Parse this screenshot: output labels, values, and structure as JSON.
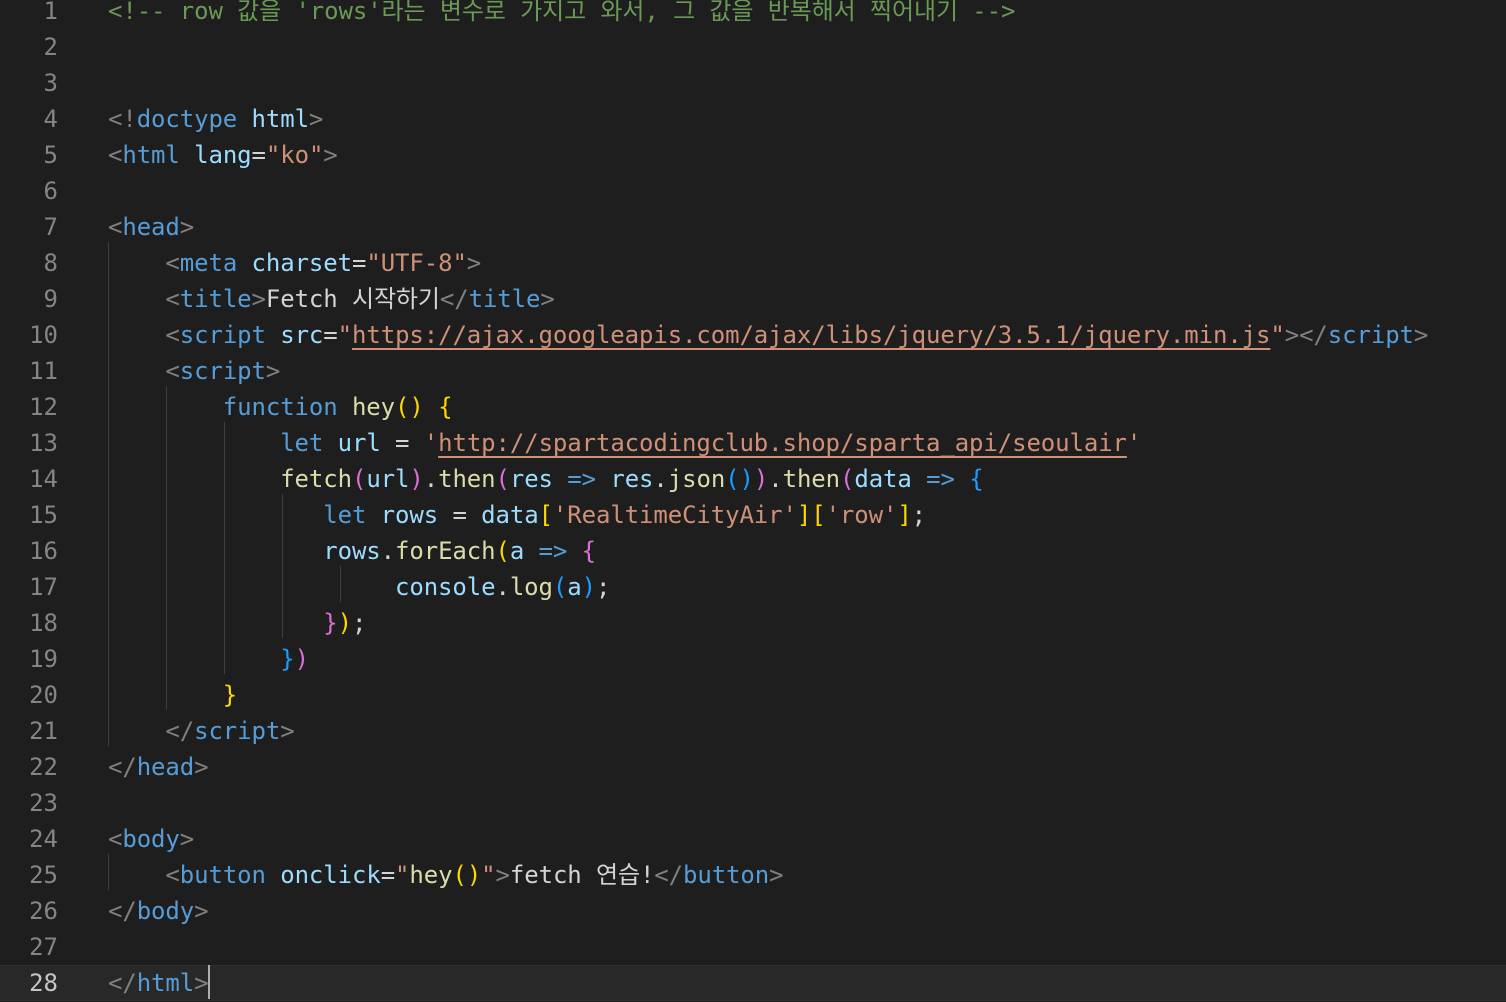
{
  "editor": {
    "theme_colors": {
      "background": "#1e1e1e",
      "line_number": "#858585",
      "comment": "#6a9955",
      "tag": "#569cd6",
      "attribute": "#9cdcfe",
      "string": "#ce9178",
      "function": "#dcdcaa",
      "bracket_1": "#ffd700",
      "bracket_2": "#da70d6",
      "bracket_3": "#179fff"
    },
    "current_line": 28,
    "lines": [
      {
        "n": "1",
        "tokens": [
          [
            "t-comment",
            "<!-- row 값을 'rows'라는 변수로 가지고 와서, 그 값을 반복해서 찍어내기 -->"
          ]
        ]
      },
      {
        "n": "2",
        "tokens": []
      },
      {
        "n": "3",
        "tokens": []
      },
      {
        "n": "4",
        "tokens": [
          [
            "t-punct",
            "<!"
          ],
          [
            "t-tag",
            "doctype"
          ],
          [
            "t-text",
            " "
          ],
          [
            "t-attr",
            "html"
          ],
          [
            "t-punct",
            ">"
          ]
        ]
      },
      {
        "n": "5",
        "tokens": [
          [
            "t-punct",
            "<"
          ],
          [
            "t-tag",
            "html"
          ],
          [
            "t-text",
            " "
          ],
          [
            "t-attr",
            "lang"
          ],
          [
            "t-text",
            "="
          ],
          [
            "t-str",
            "\"ko\""
          ],
          [
            "t-punct",
            ">"
          ]
        ]
      },
      {
        "n": "6",
        "tokens": []
      },
      {
        "n": "7",
        "tokens": [
          [
            "t-punct",
            "<"
          ],
          [
            "t-tag",
            "head"
          ],
          [
            "t-punct",
            ">"
          ]
        ]
      },
      {
        "n": "8",
        "tokens": [
          [
            "t-text",
            "    "
          ],
          [
            "t-punct",
            "<"
          ],
          [
            "t-tag",
            "meta"
          ],
          [
            "t-text",
            " "
          ],
          [
            "t-attr",
            "charset"
          ],
          [
            "t-text",
            "="
          ],
          [
            "t-str",
            "\"UTF-8\""
          ],
          [
            "t-punct",
            ">"
          ]
        ]
      },
      {
        "n": "9",
        "tokens": [
          [
            "t-text",
            "    "
          ],
          [
            "t-punct",
            "<"
          ],
          [
            "t-tag",
            "title"
          ],
          [
            "t-punct",
            ">"
          ],
          [
            "t-text",
            "Fetch 시작하기"
          ],
          [
            "t-punct",
            "</"
          ],
          [
            "t-tag",
            "title"
          ],
          [
            "t-punct",
            ">"
          ]
        ]
      },
      {
        "n": "10",
        "tokens": [
          [
            "t-text",
            "    "
          ],
          [
            "t-punct",
            "<"
          ],
          [
            "t-tag",
            "script"
          ],
          [
            "t-text",
            " "
          ],
          [
            "t-attr",
            "src"
          ],
          [
            "t-text",
            "="
          ],
          [
            "t-str",
            "\""
          ],
          [
            "t-url",
            "https://ajax.googleapis.com/ajax/libs/jquery/3.5.1/jquery.min.js"
          ],
          [
            "t-str",
            "\""
          ],
          [
            "t-punct",
            "></"
          ],
          [
            "t-tag",
            "script"
          ],
          [
            "t-punct",
            ">"
          ]
        ]
      },
      {
        "n": "11",
        "tokens": [
          [
            "t-text",
            "    "
          ],
          [
            "t-punct",
            "<"
          ],
          [
            "t-tag",
            "script"
          ],
          [
            "t-punct",
            ">"
          ]
        ]
      },
      {
        "n": "12",
        "tokens": [
          [
            "t-text",
            "        "
          ],
          [
            "t-kw",
            "function"
          ],
          [
            "t-text",
            " "
          ],
          [
            "t-fn",
            "hey"
          ],
          [
            "t-b1",
            "()"
          ],
          [
            "t-text",
            " "
          ],
          [
            "t-b1",
            "{"
          ]
        ]
      },
      {
        "n": "13",
        "tokens": [
          [
            "t-text",
            "            "
          ],
          [
            "t-kw",
            "let"
          ],
          [
            "t-text",
            " "
          ],
          [
            "t-var",
            "url"
          ],
          [
            "t-text",
            " "
          ],
          [
            "t-op",
            "="
          ],
          [
            "t-text",
            " "
          ],
          [
            "t-str",
            "'"
          ],
          [
            "t-url",
            "http://spartacodingclub.shop/sparta_api/seoulair"
          ],
          [
            "t-str",
            "'"
          ]
        ]
      },
      {
        "n": "14",
        "tokens": [
          [
            "t-text",
            "            "
          ],
          [
            "t-fn",
            "fetch"
          ],
          [
            "t-b2",
            "("
          ],
          [
            "t-var",
            "url"
          ],
          [
            "t-b2",
            ")"
          ],
          [
            "t-text",
            "."
          ],
          [
            "t-fn",
            "then"
          ],
          [
            "t-b2",
            "("
          ],
          [
            "t-var",
            "res"
          ],
          [
            "t-text",
            " "
          ],
          [
            "t-kw",
            "=>"
          ],
          [
            "t-text",
            " "
          ],
          [
            "t-var",
            "res"
          ],
          [
            "t-text",
            "."
          ],
          [
            "t-fn",
            "json"
          ],
          [
            "t-b3",
            "()"
          ],
          [
            "t-b2",
            ")"
          ],
          [
            "t-text",
            "."
          ],
          [
            "t-fn",
            "then"
          ],
          [
            "t-b2",
            "("
          ],
          [
            "t-var",
            "data"
          ],
          [
            "t-text",
            " "
          ],
          [
            "t-kw",
            "=>"
          ],
          [
            "t-text",
            " "
          ],
          [
            "t-b3",
            "{"
          ]
        ]
      },
      {
        "n": "15",
        "tokens": [
          [
            "t-text",
            "               "
          ],
          [
            "t-kw",
            "let"
          ],
          [
            "t-text",
            " "
          ],
          [
            "t-var",
            "rows"
          ],
          [
            "t-text",
            " "
          ],
          [
            "t-op",
            "="
          ],
          [
            "t-text",
            " "
          ],
          [
            "t-var",
            "data"
          ],
          [
            "t-b1",
            "["
          ],
          [
            "t-str",
            "'RealtimeCityAir'"
          ],
          [
            "t-b1",
            "]["
          ],
          [
            "t-str",
            "'row'"
          ],
          [
            "t-b1",
            "]"
          ],
          [
            "t-text",
            ";"
          ]
        ]
      },
      {
        "n": "16",
        "tokens": [
          [
            "t-text",
            "               "
          ],
          [
            "t-var",
            "rows"
          ],
          [
            "t-text",
            "."
          ],
          [
            "t-fn",
            "forEach"
          ],
          [
            "t-b1",
            "("
          ],
          [
            "t-var",
            "a"
          ],
          [
            "t-text",
            " "
          ],
          [
            "t-kw",
            "=>"
          ],
          [
            "t-text",
            " "
          ],
          [
            "t-b2",
            "{"
          ]
        ]
      },
      {
        "n": "17",
        "tokens": [
          [
            "t-text",
            "                    "
          ],
          [
            "t-var",
            "console"
          ],
          [
            "t-text",
            "."
          ],
          [
            "t-fn",
            "log"
          ],
          [
            "t-b3",
            "("
          ],
          [
            "t-var",
            "a"
          ],
          [
            "t-b3",
            ")"
          ],
          [
            "t-text",
            ";"
          ]
        ]
      },
      {
        "n": "18",
        "tokens": [
          [
            "t-text",
            "               "
          ],
          [
            "t-b2",
            "}"
          ],
          [
            "t-b1",
            ")"
          ],
          [
            "t-text",
            ";"
          ]
        ]
      },
      {
        "n": "19",
        "tokens": [
          [
            "t-text",
            "            "
          ],
          [
            "t-b3",
            "}"
          ],
          [
            "t-b2",
            ")"
          ]
        ]
      },
      {
        "n": "20",
        "tokens": [
          [
            "t-text",
            "        "
          ],
          [
            "t-b1",
            "}"
          ]
        ]
      },
      {
        "n": "21",
        "tokens": [
          [
            "t-text",
            "    "
          ],
          [
            "t-punct",
            "</"
          ],
          [
            "t-tag",
            "script"
          ],
          [
            "t-punct",
            ">"
          ]
        ]
      },
      {
        "n": "22",
        "tokens": [
          [
            "t-punct",
            "</"
          ],
          [
            "t-tag",
            "head"
          ],
          [
            "t-punct",
            ">"
          ]
        ]
      },
      {
        "n": "23",
        "tokens": []
      },
      {
        "n": "24",
        "tokens": [
          [
            "t-punct",
            "<"
          ],
          [
            "t-tag",
            "body"
          ],
          [
            "t-punct",
            ">"
          ]
        ]
      },
      {
        "n": "25",
        "tokens": [
          [
            "t-text",
            "    "
          ],
          [
            "t-punct",
            "<"
          ],
          [
            "t-tag",
            "button"
          ],
          [
            "t-text",
            " "
          ],
          [
            "t-attr",
            "onclick"
          ],
          [
            "t-text",
            "="
          ],
          [
            "t-str",
            "\""
          ],
          [
            "t-fn",
            "hey"
          ],
          [
            "t-b1",
            "()"
          ],
          [
            "t-str",
            "\""
          ],
          [
            "t-punct",
            ">"
          ],
          [
            "t-text",
            "fetch 연습!"
          ],
          [
            "t-punct",
            "</"
          ],
          [
            "t-tag",
            "button"
          ],
          [
            "t-punct",
            ">"
          ]
        ]
      },
      {
        "n": "26",
        "tokens": [
          [
            "t-punct",
            "</"
          ],
          [
            "t-tag",
            "body"
          ],
          [
            "t-punct",
            ">"
          ]
        ]
      },
      {
        "n": "27",
        "tokens": []
      },
      {
        "n": "28",
        "tokens": [
          [
            "t-punct",
            "</"
          ],
          [
            "t-tag",
            "html"
          ],
          [
            "t-punct",
            ">"
          ]
        ]
      }
    ]
  }
}
